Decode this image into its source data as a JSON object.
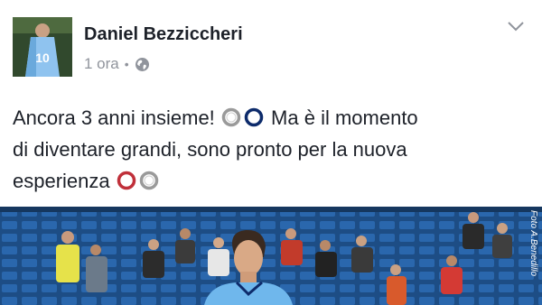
{
  "post": {
    "author": "Daniel Bezziccheri",
    "time": "1 ora",
    "separator": "•",
    "privacy_icon": "globe-icon",
    "text": {
      "line1_a": "Ancora 3 anni insieme!",
      "line1_b": "Ma è il momento",
      "line2": "di diventare grandi, sono pronto per la nuova",
      "line3": "esperienza"
    },
    "avatar_jersey_number": "10",
    "photo_credit": "Foto A.Benedillo"
  },
  "colors": {
    "author": "#1d2129",
    "meta": "#90949c",
    "lazio_blue": "#5aa7e0",
    "navy_ring": "#0d2b6b",
    "red_ring": "#c0303a",
    "gray_ring": "#9a9a9a"
  }
}
